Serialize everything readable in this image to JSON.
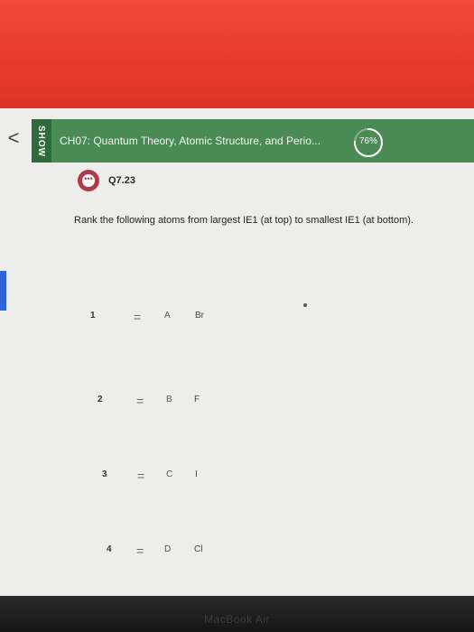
{
  "header": {
    "back_glyph": "<",
    "show_label": "SHOW",
    "title": "CH07: Quantum Theory, Atomic Structure, and Perio...",
    "progress_text": "76%",
    "progress": 0.76
  },
  "question": {
    "icon_glyph": "•••",
    "label": "Q7.23",
    "prompt": "Rank the following atoms from largest IE1 (at top) to smallest IE1 (at bottom)."
  },
  "ranking": [
    {
      "rank": "1",
      "slot": "A",
      "atom": "Br"
    },
    {
      "rank": "2",
      "slot": "B",
      "atom": "F"
    },
    {
      "rank": "3",
      "slot": "C",
      "atom": "I"
    },
    {
      "rank": "4",
      "slot": "D",
      "atom": "Cl"
    }
  ],
  "device_label": "MacBook Air",
  "colors": {
    "header_green": "#4a8a55",
    "show_tab_green": "#2f6a3b",
    "question_icon": "#b13a4a",
    "accent_blue": "#2f64d8"
  }
}
